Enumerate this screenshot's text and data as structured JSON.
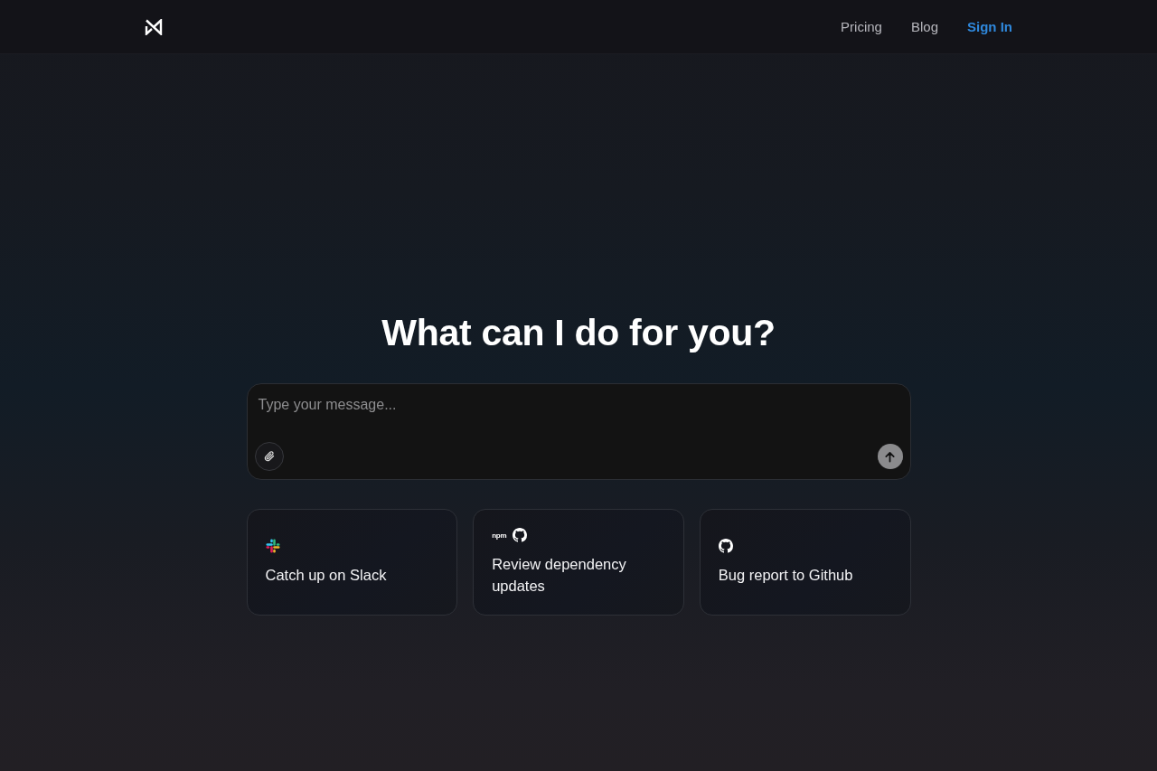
{
  "nav": {
    "links": [
      {
        "label": "Pricing",
        "kind": "link"
      },
      {
        "label": "Blog",
        "kind": "link"
      },
      {
        "label": "Sign In",
        "kind": "accent"
      }
    ]
  },
  "hero": {
    "title": "What can I do for you?"
  },
  "composer": {
    "placeholder": "Type your message..."
  },
  "suggestions": [
    {
      "icons": [
        {
          "kind": "slack"
        }
      ],
      "label": "Catch up on Slack"
    },
    {
      "icons": [
        {
          "kind": "npm",
          "text": "npm"
        },
        {
          "kind": "github"
        }
      ],
      "label": "Review dependency updates"
    },
    {
      "icons": [
        {
          "kind": "github"
        }
      ],
      "label": "Bug report to Github"
    }
  ]
}
